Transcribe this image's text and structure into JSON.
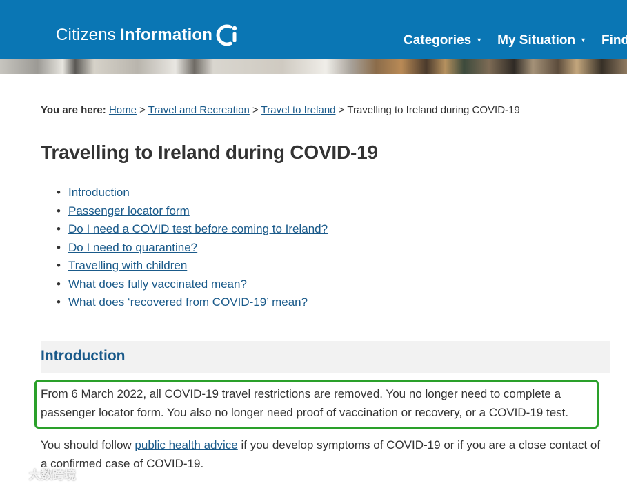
{
  "header": {
    "logo_light": "Citizens",
    "logo_bold": "Information",
    "nav": [
      {
        "label": "Categories",
        "caret": "▼"
      },
      {
        "label": "My Situation",
        "caret": "▼"
      },
      {
        "label": "Find",
        "caret": ""
      }
    ]
  },
  "breadcrumb": {
    "label": "You are here:",
    "home": "Home",
    "sep": ">",
    "level1": "Travel and Recreation",
    "level2": "Travel to Ireland",
    "current": "Travelling to Ireland during COVID-19"
  },
  "page_title": "Travelling to Ireland during COVID-19",
  "toc": [
    "Introduction",
    "Passenger locator form",
    "Do I need a COVID test before coming to Ireland?",
    "Do I need to quarantine?",
    "Travelling with children",
    "What does fully vaccinated mean?",
    "What does ‘recovered from COVID-19’ mean?"
  ],
  "section": {
    "heading": "Introduction",
    "para1_line1": "From 6 March 2022, all COVID-19 travel restrictions are removed. You no longer need to complete a",
    "para1_line2": "passenger locator form. You also no longer need proof of vaccination or recovery, or a COVID-19 test.",
    "para2_before": "You should follow ",
    "para2_link": "public health advice",
    "para2_after": " if you develop symptoms of COVID-19 or if you are a close contact of a confirmed case of COVID-19."
  },
  "watermark": {
    "text": "大数跨境"
  },
  "colors": {
    "header_bg": "#0a76b4",
    "link": "#1a5a8a",
    "highlight_border": "#2aa02a",
    "section_bg": "#f2f2f2"
  }
}
